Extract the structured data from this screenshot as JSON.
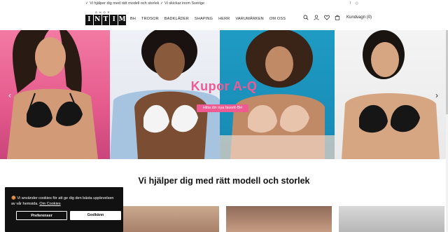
{
  "topbar": {
    "usp": "✓ Vi hjälper dig med rätt modell och storlek  ✓ Vi skickar inom Sverige",
    "social": [
      "f",
      "◎"
    ]
  },
  "header": {
    "logo": {
      "small": "SHOP",
      "letters": [
        "I",
        "N",
        "T",
        "I",
        "M"
      ]
    },
    "nav": [
      "BH",
      "TROSOR",
      "BADKLÄDER",
      "SHAPING",
      "HERR",
      "VARUMÄRKEN",
      "OM OSS"
    ],
    "cart_label": "Kundvagn (0)"
  },
  "hero": {
    "title": "Kupor A-Q",
    "button": "Hitta din nya favorit-BH"
  },
  "section": {
    "title": "Vi hjälper dig med rätt modell och storlek"
  },
  "cookie": {
    "emoji": "🍪",
    "text": "Vi använder cookies för att ge dig den bästa upplevelsen av vår hemsida.",
    "link": "Om Cookies",
    "preferences": "Preferenser",
    "accept": "Godkänn"
  },
  "colors": {
    "accent": "#f05a93",
    "dark": "#111111",
    "hero_pink": "#e55a8c",
    "hero_blue": "#1789b2"
  }
}
